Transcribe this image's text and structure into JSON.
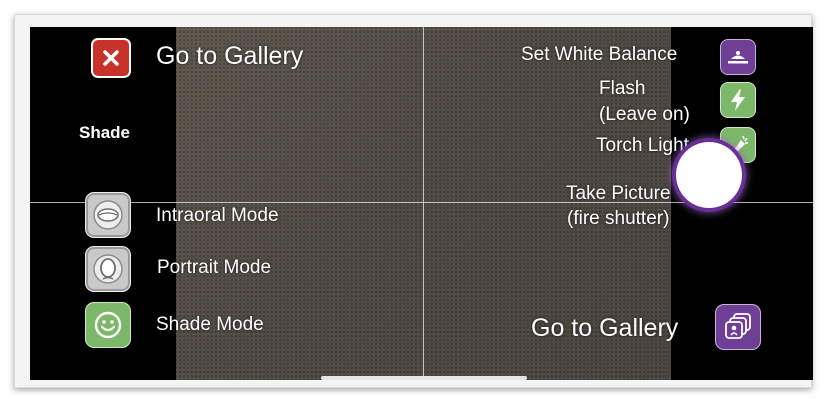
{
  "left_panel": {
    "close_label": "Go to Gallery",
    "shade_label": "Shade",
    "modes": [
      {
        "label": "Intraoral Mode"
      },
      {
        "label": "Portrait Mode"
      },
      {
        "label": "Shade Mode"
      }
    ]
  },
  "right_panel": {
    "white_balance_label": "Set White Balance",
    "flash_label_line1": "Flash",
    "flash_label_line2": "(Leave on)",
    "torch_label": "Torch Light",
    "shutter_label_line1": "Take Picture",
    "shutter_label_line2": "(fire shutter)",
    "gallery_label": "Go to Gallery"
  },
  "colors": {
    "close_red": "#c8322b",
    "green": "#7db86a",
    "purple": "#6f3f95",
    "gray": "#c9c9c9"
  },
  "icons": {
    "close": "close-x-icon",
    "white_balance": "white-balance-icon",
    "flash": "lightning-bolt-icon",
    "torch": "flashlight-icon",
    "gallery": "gallery-stack-icon",
    "intraoral": "mouth-icon",
    "portrait": "face-outline-icon",
    "shade": "smiley-face-icon"
  }
}
